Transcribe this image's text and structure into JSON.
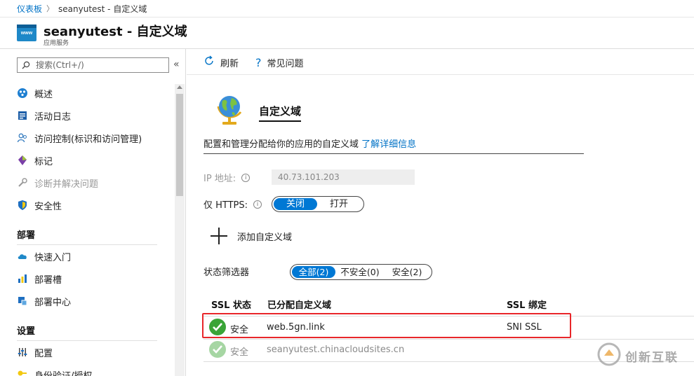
{
  "breadcrumb": {
    "home": "仪表板",
    "current": "seanyutest - 自定义域"
  },
  "header": {
    "app_icon_text": "www",
    "title": "seanyutest - 自定义域",
    "subtitle": "应用服务"
  },
  "sidebar": {
    "search_placeholder": "搜索(Ctrl+/)",
    "collapse_glyph": "«",
    "top_items": [
      {
        "label": "概述",
        "icon": "overview-icon"
      },
      {
        "label": "活动日志",
        "icon": "activity-log-icon"
      },
      {
        "label": "访问控制(标识和访问管理)",
        "icon": "access-control-icon"
      },
      {
        "label": "标记",
        "icon": "tag-icon"
      },
      {
        "label": "诊断并解决问题",
        "icon": "wrench-icon",
        "disabled": true
      },
      {
        "label": "安全性",
        "icon": "shield-icon"
      }
    ],
    "section_deploy": "部署",
    "deploy_items": [
      {
        "label": "快速入门",
        "icon": "cloud-icon"
      },
      {
        "label": "部署槽",
        "icon": "slots-icon"
      },
      {
        "label": "部署中心",
        "icon": "deployment-center-icon"
      }
    ],
    "section_settings": "设置",
    "settings_items": [
      {
        "label": "配置",
        "icon": "config-icon"
      },
      {
        "label": "身份验证/授权",
        "icon": "key-icon"
      }
    ]
  },
  "toolbar": {
    "refresh": "刷新",
    "faq": "常见问题"
  },
  "main": {
    "heading": "自定义域",
    "description": "配置和管理分配给你的应用的自定义域 ",
    "learn_more": "了解详细信息",
    "ip_label": "IP 地址:",
    "ip_value": "40.73.101.203",
    "https_label": "仅 HTTPS:",
    "https_off": "关闭",
    "https_on": "打开",
    "add_domain": "添加自定义域",
    "filter_label": "状态筛选器",
    "filter_all": "全部(2)",
    "filter_insecure": "不安全(0)",
    "filter_secure": "安全(2)"
  },
  "table": {
    "headers": {
      "status": "SSL 状态",
      "domain": "已分配自定义域",
      "binding": "SSL 绑定"
    },
    "rows": [
      {
        "status": "安全",
        "domain": "web.5gn.link",
        "binding": "SNI SSL"
      },
      {
        "status": "安全",
        "domain": "seanyutest.chinacloudsites.cn",
        "binding": ""
      }
    ]
  },
  "watermark": {
    "text": "创新互联"
  },
  "colors": {
    "accent": "#0078d4",
    "link": "#0072c6",
    "success": "#3aa437",
    "highlight": "#e8262a"
  }
}
